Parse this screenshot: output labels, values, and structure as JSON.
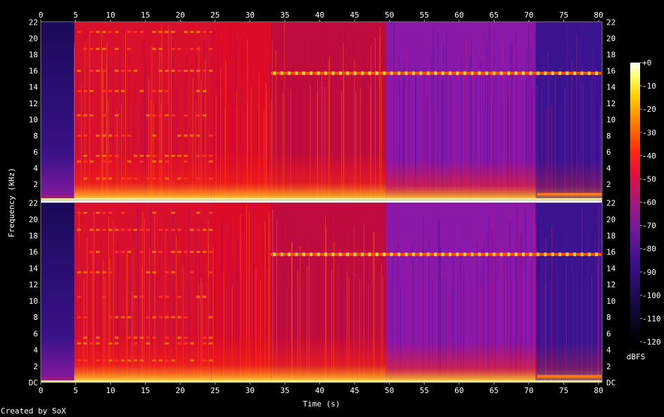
{
  "chart_data": {
    "type": "heatmap",
    "xlabel": "Time (s)",
    "ylabel": "Frequency (kHz)",
    "x_ticks": [
      0,
      5,
      10,
      15,
      20,
      25,
      30,
      35,
      40,
      45,
      50,
      55,
      60,
      65,
      70,
      75,
      80
    ],
    "xlim": [
      0,
      80.5
    ],
    "channels": [
      {
        "y_ticks": [
          "22",
          "20",
          "18",
          "16",
          "14",
          "12",
          "10",
          "8",
          "6",
          "4",
          "2"
        ]
      },
      {
        "y_ticks": [
          "22",
          "20",
          "18",
          "16",
          "14",
          "12",
          "10",
          "8",
          "6",
          "4",
          "2",
          "DC"
        ]
      }
    ],
    "ylim_khz": [
      0,
      22.05
    ],
    "colorbar": {
      "label": "dBFS",
      "ticks": [
        "+0",
        "-10",
        "-20",
        "-30",
        "-40",
        "-50",
        "-60",
        "-70",
        "-80",
        "-90",
        "-100",
        "-110",
        "-120"
      ],
      "range": [
        -120,
        0
      ]
    },
    "segments_s": [
      {
        "start": 0,
        "end": 4.8,
        "level": "low"
      },
      {
        "start": 4.8,
        "end": 24.5,
        "level": "high, harmonic"
      },
      {
        "start": 24.5,
        "end": 33,
        "level": "high, transient"
      },
      {
        "start": 33,
        "end": 49.5,
        "level": "high, tone at 16 kHz"
      },
      {
        "start": 49.5,
        "end": 71,
        "level": "medium"
      },
      {
        "start": 71,
        "end": 80.5,
        "level": "low, tone at 16 kHz"
      }
    ],
    "footer": "Created by SoX"
  }
}
